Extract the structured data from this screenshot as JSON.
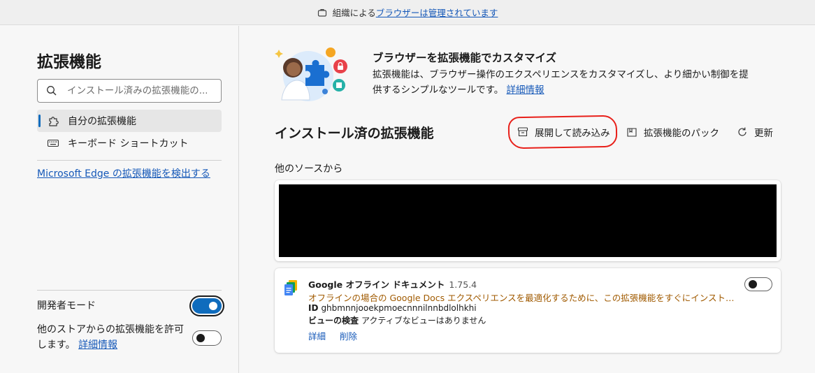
{
  "banner": {
    "prefix": "組織による",
    "link": "ブラウザーは管理されています"
  },
  "sidebar": {
    "title": "拡張機能",
    "search_placeholder": "インストール済みの拡張機能の...",
    "nav": [
      {
        "label": "自分の拡張機能",
        "icon": "puzzle-icon",
        "active": true
      },
      {
        "label": "キーボード ショートカット",
        "icon": "keyboard-icon",
        "active": false
      }
    ],
    "discover_link": "Microsoft Edge の拡張機能を検出する",
    "developer_mode": {
      "label": "開発者モード",
      "enabled": true
    },
    "other_stores": {
      "label": "他のストアからの拡張機能を許可します。",
      "link": "詳細情報",
      "enabled": false
    }
  },
  "hero": {
    "title": "ブラウザーを拡張機能でカスタマイズ",
    "description": "拡張機能は、ブラウザー操作のエクスペリエンスをカスタマイズし、より細かい制御を提供するシンプルなツールです。",
    "link": "詳細情報"
  },
  "installed": {
    "title": "インストール済の拡張機能",
    "actions": {
      "load_unpacked": "展開して読み込み",
      "pack": "拡張機能のパック",
      "update": "更新"
    },
    "other_sources_label": "他のソースから"
  },
  "extension": {
    "name": "Google オフライン ドキュメント",
    "version": "1.75.4",
    "description": "オフラインの場合の Google Docs エクスペリエンスを最適化するために、この拡張機能をすぐにインストールし...",
    "id_label": "ID",
    "id_value": "ghbmnnjooekpmoecnnnilnnbdlolhkhi",
    "inspect_label": "ビューの検査",
    "inspect_value": "アクティブなビューはありません",
    "details_link": "詳細",
    "remove_link": "削除",
    "enabled": false
  },
  "colors": {
    "accent": "#0f6cbd",
    "link": "#1558b8",
    "warning_text": "#a05a00",
    "annotation": "#e8201a"
  }
}
